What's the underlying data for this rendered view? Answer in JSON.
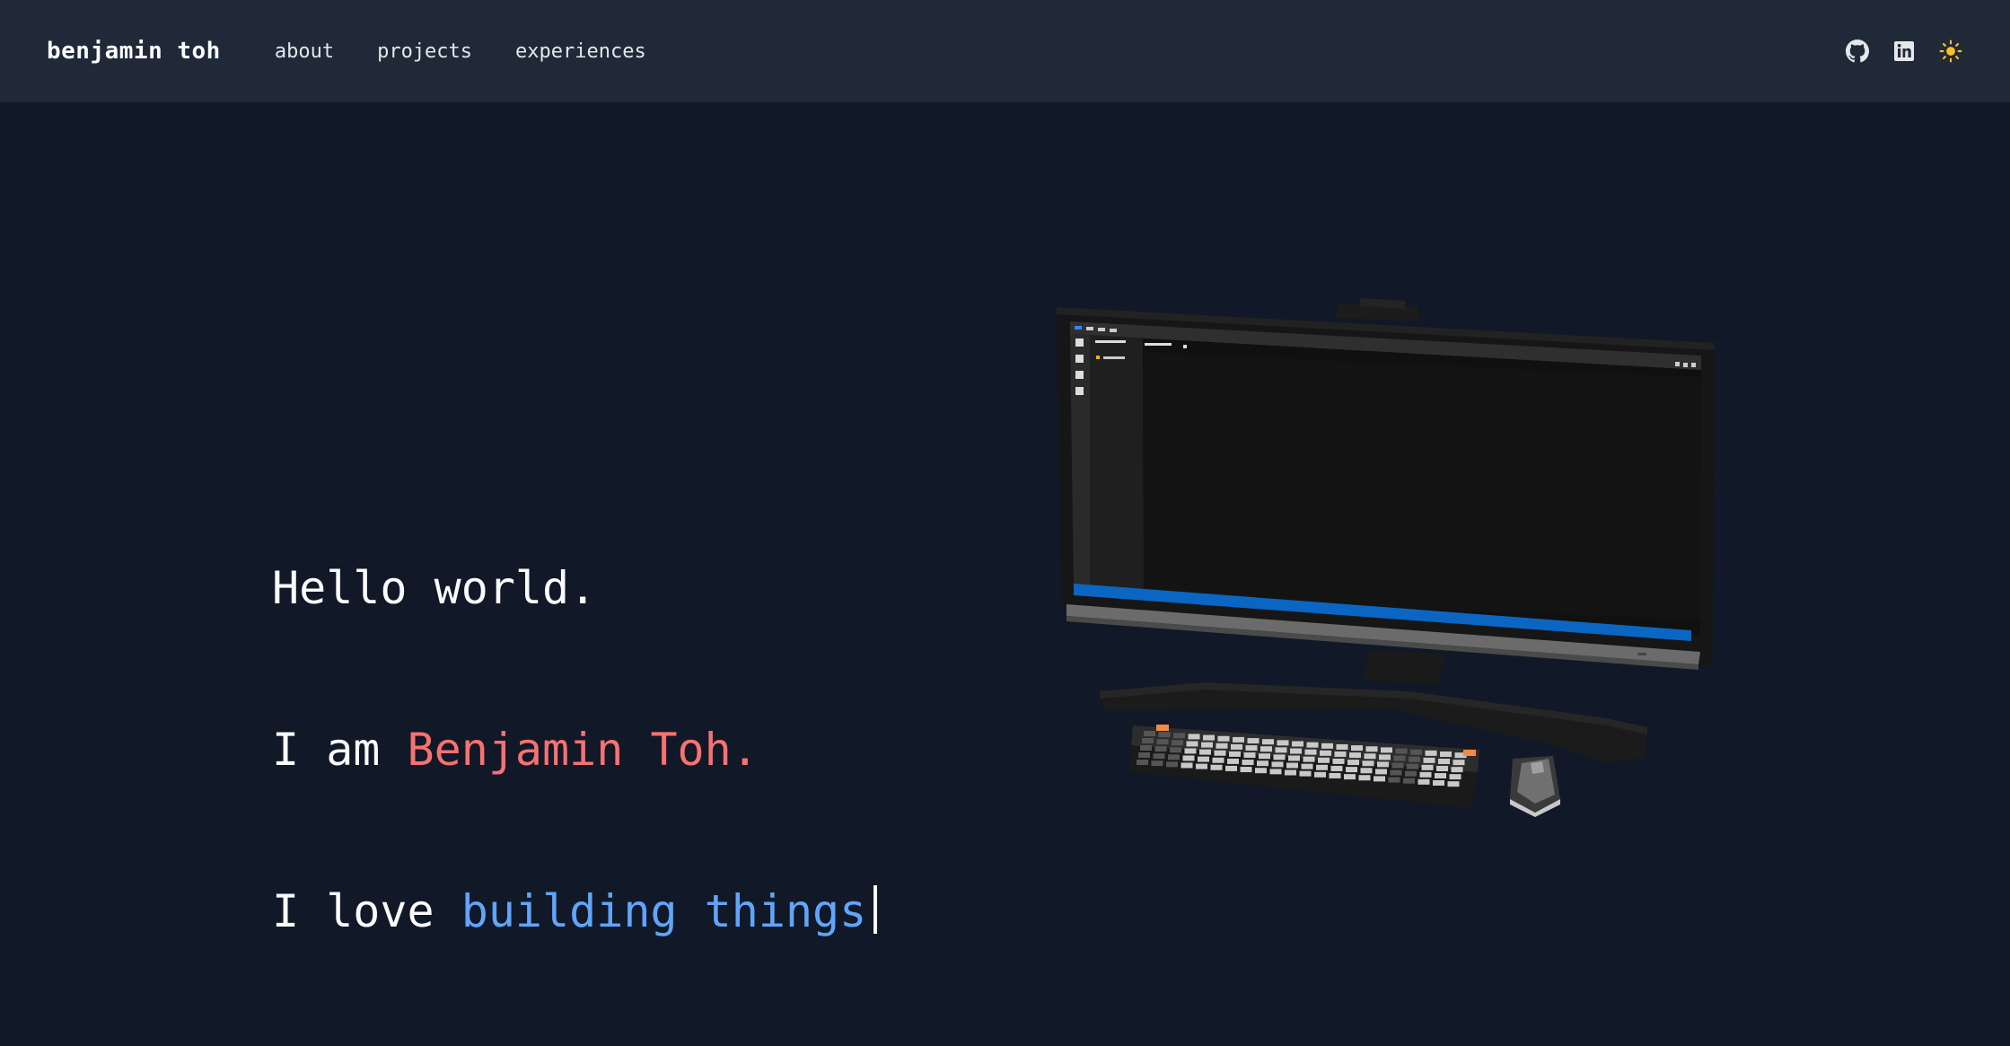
{
  "navbar": {
    "brand": "benjamin toh",
    "links": [
      {
        "label": "about"
      },
      {
        "label": "projects"
      },
      {
        "label": "experiences"
      }
    ],
    "icons": [
      "github-icon",
      "linkedin-icon",
      "sun-icon"
    ]
  },
  "hero": {
    "line1": "Hello world.",
    "line2_prefix": "I am ",
    "line2_name": "Benjamin Toh.",
    "line3_prefix": "I love ",
    "line3_typed": "building things"
  },
  "colors": {
    "background": "#111827",
    "navbar": "#1f2937",
    "name_accent": "#f87171",
    "typed_accent": "#60a5fa",
    "sun_icon": "#fbbf24"
  }
}
